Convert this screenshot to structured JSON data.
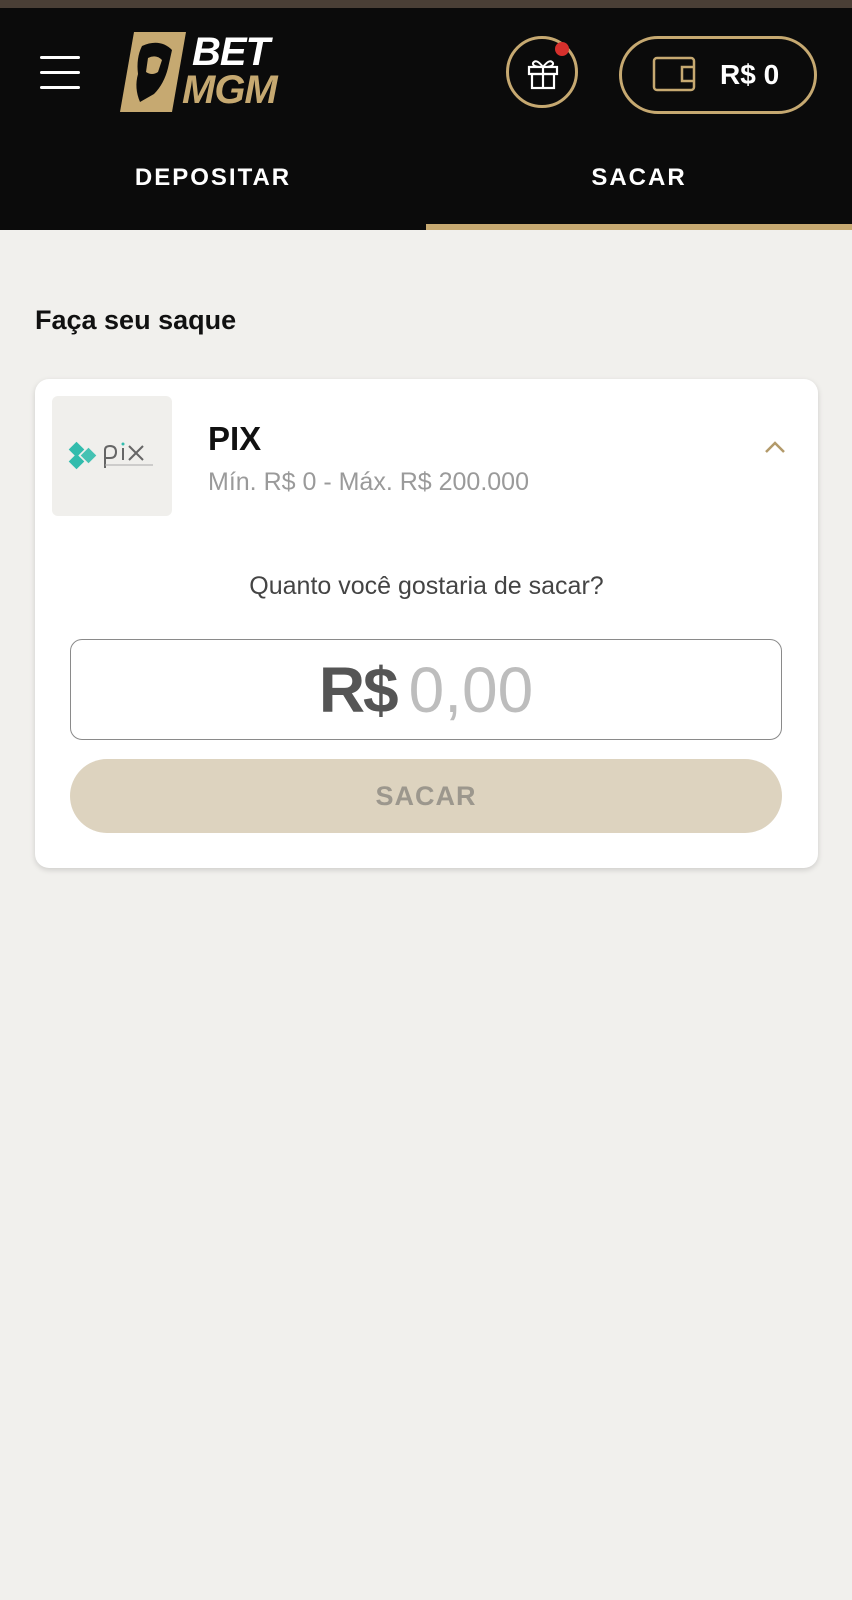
{
  "header": {
    "logo": {
      "line1": "BET",
      "line2": "MGM"
    },
    "wallet": {
      "amount": "R$ 0"
    }
  },
  "tabs": [
    {
      "label": "DEPOSITAR",
      "active": false
    },
    {
      "label": "SACAR",
      "active": true
    }
  ],
  "section_title": "Faça seu saque",
  "payment": {
    "name": "PIX",
    "range": "Mín. R$ 0 - Máx. R$ 200.000",
    "question": "Quanto você gostaria de sacar?",
    "currency": "R$",
    "amount_placeholder": "0,00",
    "submit_label": "SACAR"
  },
  "colors": {
    "header_bg": "#0b0b0b",
    "accent_gold": "#c6a971",
    "notification_dot": "#d6302c",
    "page_bg": "#f1f0ed",
    "disabled_button": "#ddd3bf",
    "pix_teal": "#32bcad"
  },
  "icons": [
    "menu-icon",
    "gift-icon",
    "wallet-icon",
    "chevron-up-icon",
    "pix-logo-icon"
  ]
}
